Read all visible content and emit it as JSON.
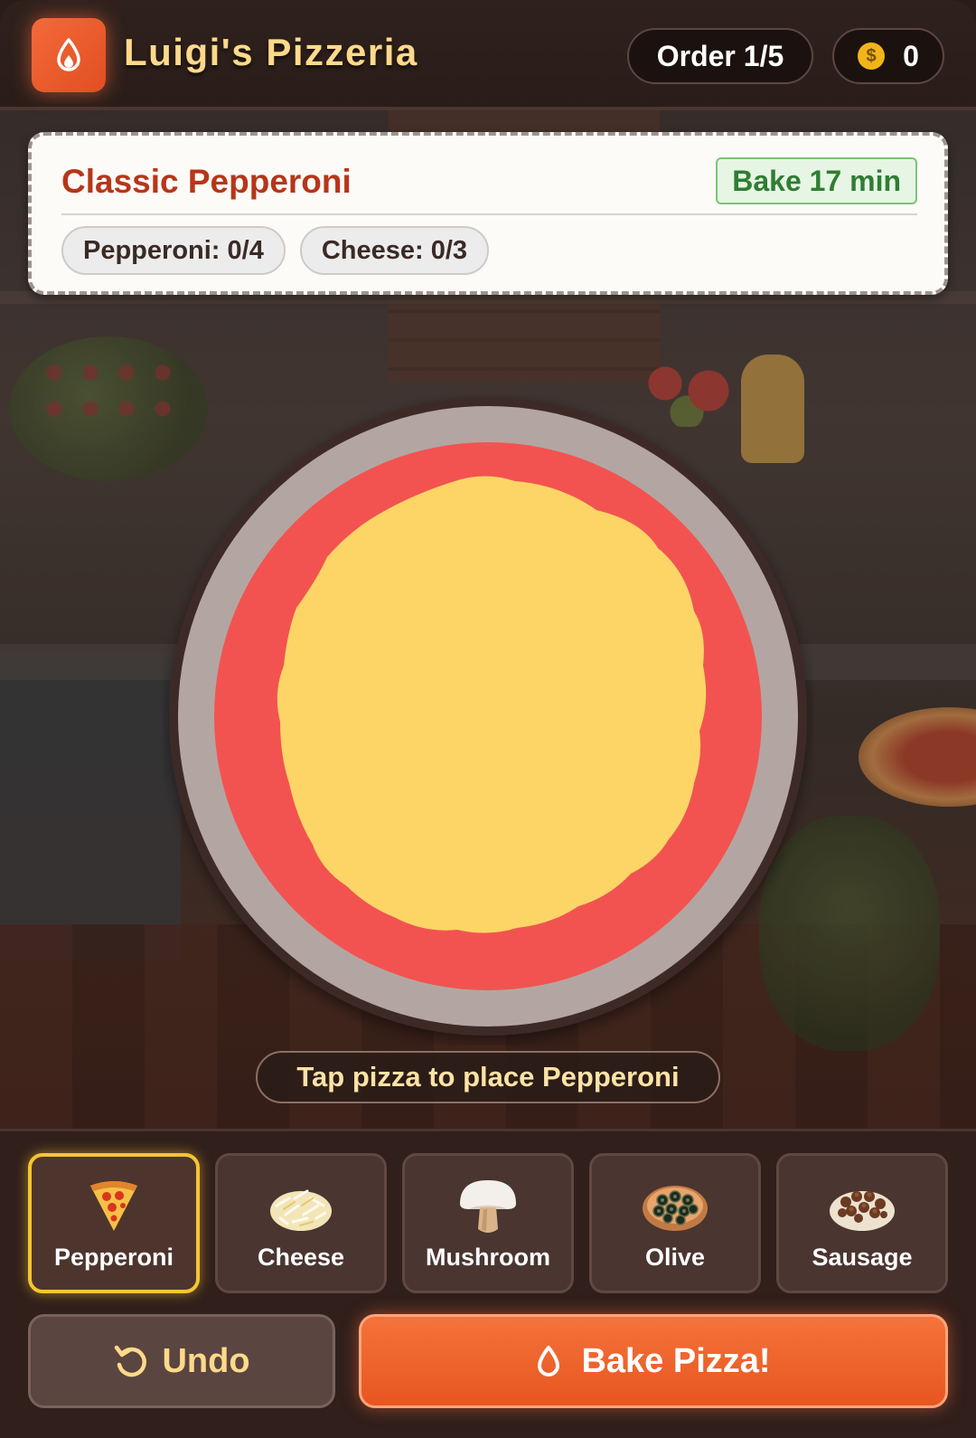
{
  "header": {
    "title": "Luigi's Pizzeria",
    "logo_icon": "flame-icon",
    "order_label": "Order 1/5",
    "coin_icon": "coin-icon",
    "coin_symbol": "$",
    "coins": "0"
  },
  "order": {
    "name": "Classic Pepperoni",
    "bake_time": "Bake 17 min",
    "requirements": [
      {
        "label": "Pepperoni: 0/4"
      },
      {
        "label": "Cheese: 0/3"
      }
    ]
  },
  "pizza": {
    "crust_color": "#b3a6a2",
    "sauce_color": "#f25350",
    "cheese_color": "#fdd566",
    "hint": "Tap pizza to place Pepperoni"
  },
  "toppings": [
    {
      "label": "Pepperoni",
      "icon": "pizza-slice-icon",
      "selected": true
    },
    {
      "label": "Cheese",
      "icon": "shredded-cheese-icon",
      "selected": false
    },
    {
      "label": "Mushroom",
      "icon": "mushroom-icon",
      "selected": false
    },
    {
      "label": "Olive",
      "icon": "olive-icon",
      "selected": false
    },
    {
      "label": "Sausage",
      "icon": "sausage-icon",
      "selected": false
    }
  ],
  "actions": {
    "undo_label": "Undo",
    "undo_icon": "undo-icon",
    "bake_label": "Bake Pizza!",
    "bake_icon": "flame-icon"
  },
  "colors": {
    "accent": "#f26a3a",
    "title": "#ffd98a",
    "selected_border": "#f5c531"
  }
}
